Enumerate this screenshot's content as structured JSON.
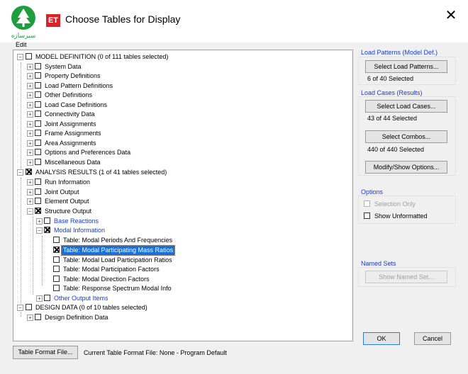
{
  "window": {
    "title": "Choose Tables for Display",
    "app_badge": "ET",
    "logo_text": "سبزسازه",
    "close_symbol": "✕"
  },
  "menu": {
    "edit": "Edit"
  },
  "tree": {
    "model_definition": "MODEL DEFINITION  (0 of 111 tables selected)",
    "md_items": [
      "System Data",
      "Property Definitions",
      "Load Pattern Definitions",
      "Other Definitions",
      "Load Case Definitions",
      "Connectivity Data",
      "Joint Assignments",
      "Frame Assignments",
      "Area Assignments",
      "Options and Preferences Data",
      "Miscellaneous Data"
    ],
    "analysis_results": "ANALYSIS RESULTS  (1 of 41 tables selected)",
    "ar_items": [
      "Run Information",
      "Joint Output",
      "Element Output",
      "Structure Output"
    ],
    "base_reactions": "Base Reactions",
    "modal_information": "Modal Information",
    "modal_tables": [
      "Table:  Modal Periods And Frequencies",
      "Table:  Modal Participating Mass Ratios",
      "Table:  Modal Load Participation Ratios",
      "Table:  Modal Participation Factors",
      "Table:  Modal Direction Factors",
      "Table:  Response Spectrum Modal Info"
    ],
    "other_output": "Other Output Items",
    "design_data": "DESIGN DATA  (0 of 10 tables selected)",
    "dd_items": [
      "Design Definition Data"
    ]
  },
  "load_patterns": {
    "title": "Load Patterns (Model Def.)",
    "button": "Select Load Patterns...",
    "status": "6 of 40 Selected"
  },
  "load_cases": {
    "title": "Load Cases (Results)",
    "cases_button": "Select Load Cases...",
    "cases_status": "43 of 44 Selected",
    "combos_button": "Select Combos...",
    "combos_status": "440 of 440 Selected",
    "modify_button": "Modify/Show Options..."
  },
  "options": {
    "title": "Options",
    "selection_only": "Selection Only",
    "show_unformatted": "Show Unformatted"
  },
  "named_sets": {
    "title": "Named Sets",
    "button": "Show Named Set..."
  },
  "footer": {
    "format_button": "Table Format File...",
    "format_label": "Current Table Format File:  None - Program Default",
    "ok": "OK",
    "cancel": "Cancel"
  },
  "colors": {
    "accent": "#1a6fd8",
    "badge": "#d8232a",
    "link": "#1a3cc8",
    "logo": "#1e9e3e"
  }
}
